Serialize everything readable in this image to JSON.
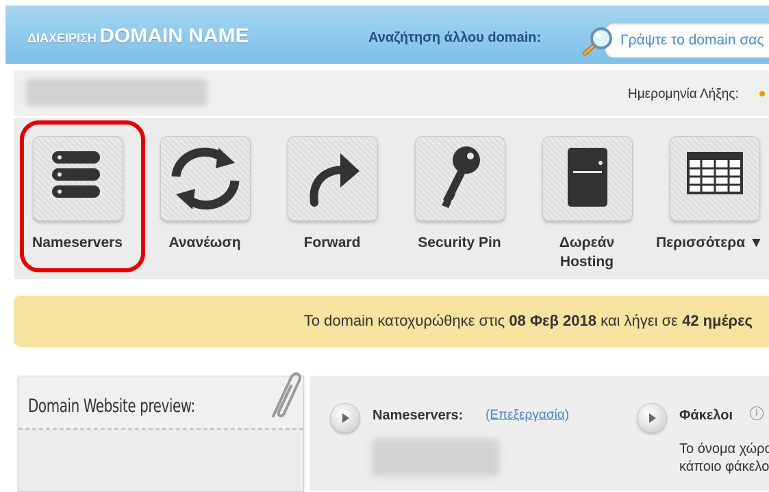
{
  "header": {
    "brand_small": "ΔΙΑΧΕΙΡΙΣΗ",
    "brand_big": "DOMAIN NAME",
    "search_label": "Αναζήτηση άλλου domain:",
    "search_placeholder": "Γράψτε το domain σας"
  },
  "info_bar": {
    "expiry_label": "Ημερομηνία Λήξης:"
  },
  "toolbar": {
    "items": [
      {
        "label": "Nameservers",
        "icon": "server-stack-icon"
      },
      {
        "label": "Ανανέωση",
        "icon": "refresh-icon"
      },
      {
        "label": "Forward",
        "icon": "forward-arrow-icon"
      },
      {
        "label": "Security Pin",
        "icon": "key-icon"
      },
      {
        "label_line1": "Δωρεάν",
        "label_line2": "Hosting",
        "icon": "hosting-box-icon"
      },
      {
        "label": "Περισσότερα ▼",
        "icon": "table-grid-icon"
      }
    ],
    "highlight_color": "#e50000"
  },
  "notice": {
    "prefix": "Το domain κατοχυρώθηκε στις ",
    "date": "08 Φεβ 2018",
    "middle": " και λήγει σε ",
    "days": "42 ημέρες"
  },
  "preview": {
    "title": "Domain Website preview:"
  },
  "details": {
    "nameservers_label": "Nameservers:",
    "edit_link": "(Επεξεργασία)",
    "folders_label": "Φάκελοι",
    "folders_text_line1": "Το όνομα χώρου",
    "folders_text_line2": "κάποιο φάκελο"
  },
  "colors": {
    "header": "#8ccbee",
    "notice": "#f7e3a0",
    "link": "#4a85c8"
  }
}
